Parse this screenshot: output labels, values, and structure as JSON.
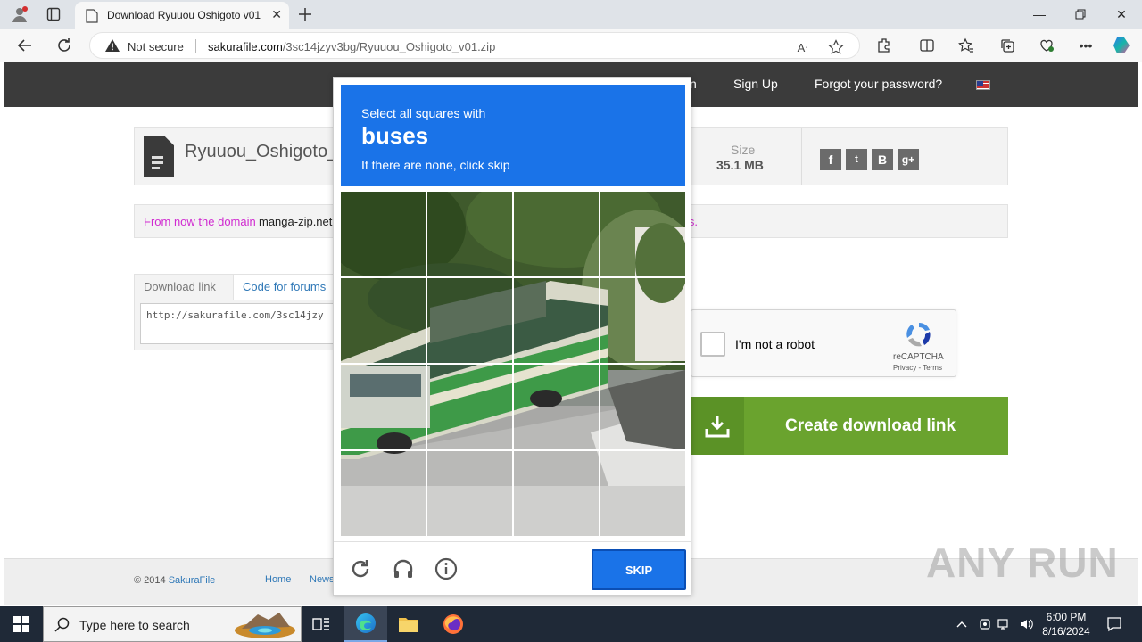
{
  "browser": {
    "tab_title": "Download Ryuuou Oshigoto v01",
    "address": {
      "security_label": "Not secure",
      "host": "sakurafile.com",
      "path": "/3sc14jzyv3bg/Ryuuou_Oshigoto_v01.zip"
    }
  },
  "site": {
    "header": {
      "links": [
        {
          "label": "n"
        },
        {
          "label": "Sign Up"
        },
        {
          "label": "Forgot your password?"
        }
      ]
    },
    "file": {
      "name": "Ryuuou_Oshigoto_v",
      "size_label": "Size",
      "size_value": "35.1 MB",
      "social": [
        "f",
        "t",
        "B",
        "g+"
      ]
    },
    "notice": {
      "part1": "From now the domain",
      "domain": "manga-zip.net",
      "tail": "rks."
    },
    "download_tabs": [
      "Download link",
      "Code for forums"
    ],
    "download_link_value": "http://sakurafile.com/3sc14jzy",
    "recaptcha": {
      "label": "I'm not a robot",
      "brand": "reCAPTCHA",
      "terms": "Privacy - Terms"
    },
    "create_button": "Create download link",
    "footer": {
      "copyright": "© 2014",
      "brand": "SakuraFile",
      "links": [
        "Home",
        "News"
      ]
    }
  },
  "captcha": {
    "line1": "Select all squares with",
    "target": "buses",
    "line3": "If there are none, click skip",
    "skip_label": "SKIP"
  },
  "watermark": "ANY RUN",
  "taskbar": {
    "search_placeholder": "Type here to search",
    "time": "6:00 PM",
    "date": "8/16/2024"
  },
  "colors": {
    "captcha_blue": "#1a73e8",
    "create_green": "#6aa32e",
    "notice_magenta": "#d02bd0",
    "link_blue": "#2f78b7"
  }
}
